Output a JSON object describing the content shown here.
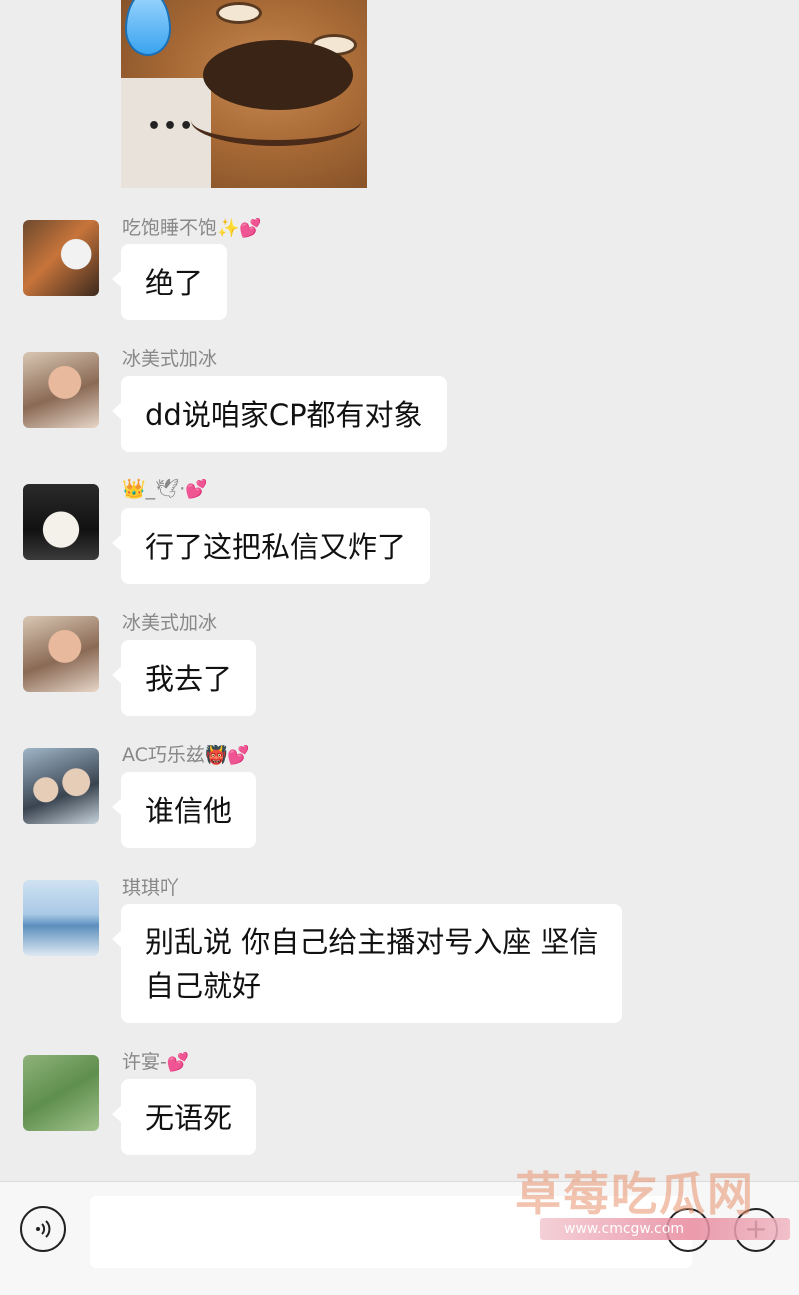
{
  "messages": [
    {
      "nickname": "吃饱睡不饱",
      "emoji": "✨💕",
      "text": "绝了"
    },
    {
      "nickname": "冰美式加冰",
      "emoji": "",
      "text": "dd说咱家CP都有对象"
    },
    {
      "nickname": "👑_🕊·",
      "emoji": "💕",
      "text": "行了这把私信又炸了"
    },
    {
      "nickname": "冰美式加冰",
      "emoji": "",
      "text": "我去了"
    },
    {
      "nickname": "AC巧乐兹",
      "emoji": "👹💕",
      "text": "谁信他"
    },
    {
      "nickname": "琪琪吖",
      "emoji": "",
      "text_line1": "别乱说 你自己给主播对号入座 坚信",
      "text_line2": "自己就好"
    },
    {
      "nickname": "许宴-",
      "emoji": "💕",
      "text": "无语死"
    }
  ],
  "sticker": {
    "overlay": "•••"
  },
  "input_bar": {
    "voice_icon": "voice-icon",
    "emoji_icon": "emoji-icon",
    "plus_icon": "plus-icon",
    "plus_symbol": "+"
  },
  "watermark": {
    "main": "草莓吃瓜网",
    "url": "www.cmcgw.com"
  }
}
